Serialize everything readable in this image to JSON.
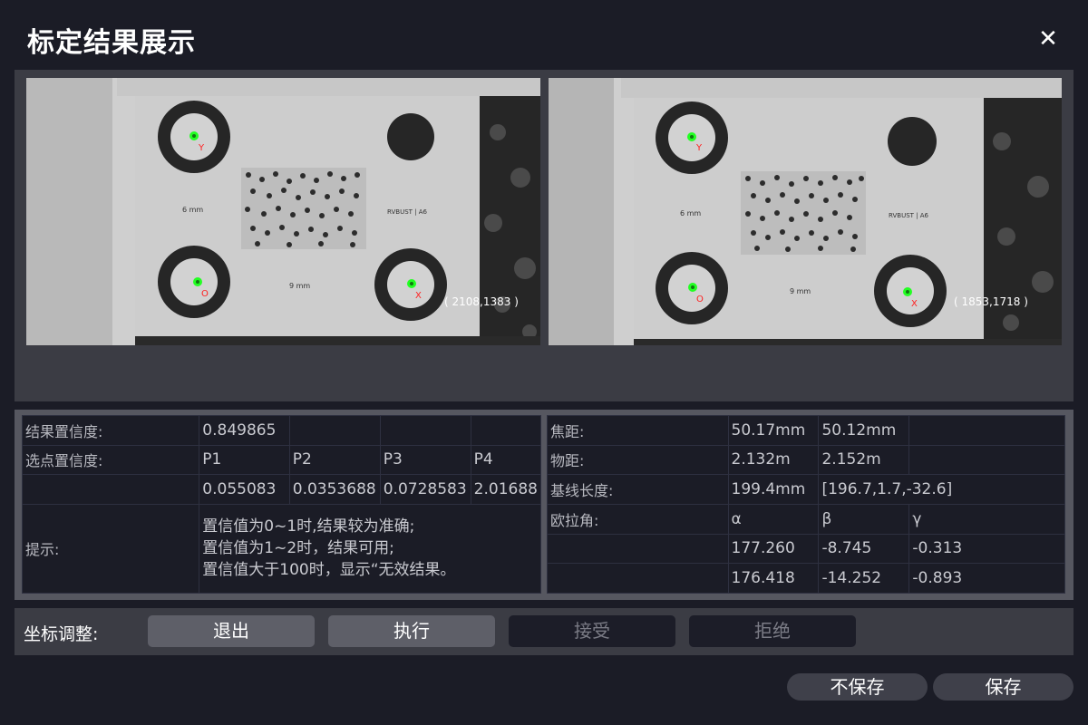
{
  "dialog": {
    "title": "标定结果展示",
    "close_icon": "close-icon"
  },
  "images": {
    "left": {
      "coord": "( 2108,1383 )",
      "board_label": "RVBUST | A6",
      "scale_label_top": "6 mm",
      "scale_label_bottom": "9 mm",
      "marker_labels": [
        "Y",
        "O",
        "X"
      ]
    },
    "right": {
      "coord": "( 1853,1718 )",
      "board_label": "RVBUST | A6",
      "scale_label_top": "6 mm",
      "scale_label_bottom": "9 mm",
      "marker_labels": [
        "Y",
        "O",
        "X"
      ]
    }
  },
  "left_table": {
    "result_confidence_label": "结果置信度:",
    "result_confidence_value": "0.849865",
    "point_confidence_label": "选点置信度:",
    "points": [
      "P1",
      "P2",
      "P3",
      "P4"
    ],
    "point_values": [
      "0.055083",
      "0.0353688",
      "0.0728583",
      "2.01688"
    ],
    "tips_label": "提示:",
    "tips": [
      "置信值为0~1时,结果较为准确;",
      "置信值为1~2时，结果可用;",
      "置信值大于100时，显示“无效结果。"
    ]
  },
  "right_table": {
    "focal_label": "焦距:",
    "focal_values": [
      "50.17mm",
      "50.12mm"
    ],
    "distance_label": "物距:",
    "distance_values": [
      "2.132m",
      "2.152m"
    ],
    "baseline_label": "基线长度:",
    "baseline_values": [
      "199.4mm",
      "[196.7,1.7,-32.6]"
    ],
    "euler_label": "欧拉角:",
    "euler_headers": [
      "α",
      "β",
      "γ"
    ],
    "euler_rows": [
      [
        "177.260",
        "-8.745",
        "-0.313"
      ],
      [
        "176.418",
        "-14.252",
        "-0.893"
      ]
    ]
  },
  "adjust": {
    "label": "坐标调整:",
    "exit": "退出",
    "execute": "执行",
    "accept": "接受",
    "reject": "拒绝"
  },
  "footer": {
    "no_save": "不保存",
    "save": "保存"
  },
  "colors": {
    "background": "#1b1c26",
    "panel": "#3b3c44",
    "button_enabled": "#5e5f68",
    "button_disabled": "#1c1d28",
    "marker_green": "#22ff22",
    "marker_label_red": "#ff2020"
  }
}
